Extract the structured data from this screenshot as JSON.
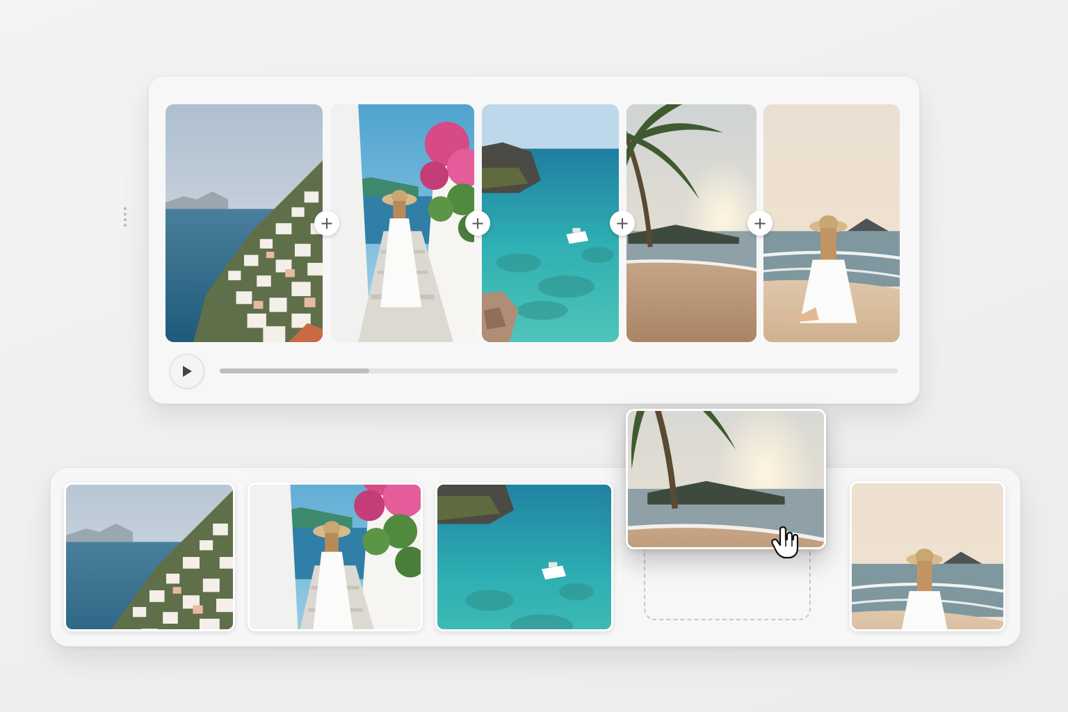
{
  "editor": {
    "clips": [
      {
        "name": "clip-cliff-town",
        "scene": "cliff-village"
      },
      {
        "name": "clip-alley-walk",
        "scene": "alley-woman"
      },
      {
        "name": "clip-turquoise-cove",
        "scene": "cove-boat"
      },
      {
        "name": "clip-palm-sunset",
        "scene": "palm-beach"
      },
      {
        "name": "clip-beach-sitting",
        "scene": "beach-woman"
      }
    ],
    "transition_icon": "plus-icon",
    "playback": {
      "play_icon": "play-icon",
      "progress": 0.22
    }
  },
  "strip": {
    "thumbnails": [
      "cliff-village",
      "alley-woman",
      "cove-boat",
      "beach-woman"
    ],
    "dragging": "palm-beach",
    "cursor_icon": "hand-pointer-icon",
    "drag_handle_icon": "vertical-dots-icon"
  },
  "colors": {
    "sea": "#2f6f8e",
    "turquoise": "#3cb7b0",
    "sand": "#d9b896",
    "sky": "#c9d9e6",
    "sunset": "#f1dcc2"
  }
}
